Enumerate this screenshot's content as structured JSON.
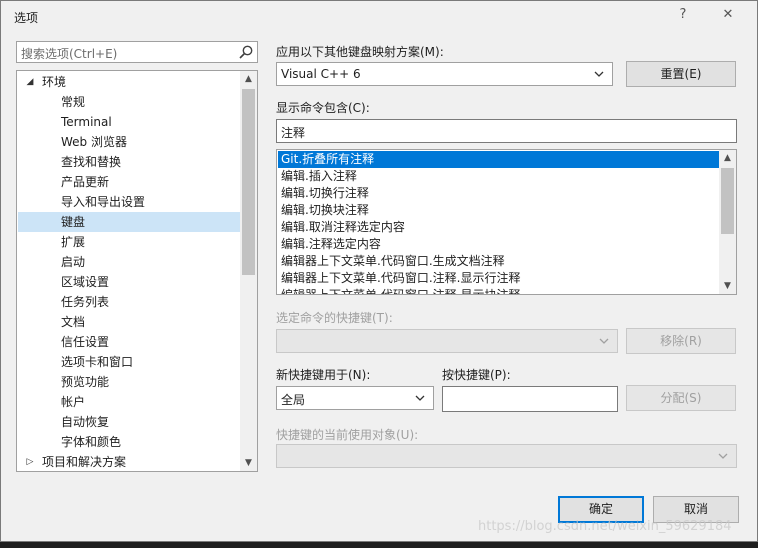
{
  "window": {
    "title": "选项",
    "help_label": "?",
    "close_label": "✕"
  },
  "search": {
    "placeholder": "搜索选项(Ctrl+E)"
  },
  "tree": {
    "items": [
      {
        "label": "环境",
        "level": 0,
        "expanded": true
      },
      {
        "label": "常规",
        "level": 1
      },
      {
        "label": "Terminal",
        "level": 1
      },
      {
        "label": "Web 浏览器",
        "level": 1
      },
      {
        "label": "查找和替换",
        "level": 1
      },
      {
        "label": "产品更新",
        "level": 1
      },
      {
        "label": "导入和导出设置",
        "level": 1
      },
      {
        "label": "键盘",
        "level": 1,
        "selected": true
      },
      {
        "label": "扩展",
        "level": 1
      },
      {
        "label": "启动",
        "level": 1
      },
      {
        "label": "区域设置",
        "level": 1
      },
      {
        "label": "任务列表",
        "level": 1
      },
      {
        "label": "文档",
        "level": 1
      },
      {
        "label": "信任设置",
        "level": 1
      },
      {
        "label": "选项卡和窗口",
        "level": 1
      },
      {
        "label": "预览功能",
        "level": 1
      },
      {
        "label": "帐户",
        "level": 1
      },
      {
        "label": "自动恢复",
        "level": 1
      },
      {
        "label": "字体和颜色",
        "level": 1
      },
      {
        "label": "项目和解决方案",
        "level": 0,
        "expanded": false
      }
    ]
  },
  "keymap": {
    "label": "应用以下其他键盘映射方案(M):",
    "value": "Visual C++ 6",
    "reset_label": "重置(E)"
  },
  "filter": {
    "label": "显示命令包含(C):",
    "value": "注释"
  },
  "commands": [
    "Git.折叠所有注释",
    "编辑.插入注释",
    "编辑.切换行注释",
    "编辑.切换块注释",
    "编辑.取消注释选定内容",
    "编辑.注释选定内容",
    "编辑器上下文菜单.代码窗口.生成文档注释",
    "编辑器上下文菜单.代码窗口.注释.显示行注释",
    "编辑器上下文菜单.代码窗口.注释.显示块注释"
  ],
  "selected_shortcuts": {
    "label": "选定命令的快捷键(T):",
    "remove_label": "移除(R)"
  },
  "new_shortcut": {
    "scope_label": "新快捷键用于(N):",
    "scope_value": "全局",
    "press_label": "按快捷键(P):",
    "press_value": "",
    "assign_label": "分配(S)"
  },
  "used_by": {
    "label": "快捷键的当前使用对象(U):"
  },
  "footer": {
    "ok_label": "确定",
    "cancel_label": "取消"
  },
  "watermark": "https://blog.csdn.net/weixin_59629184",
  "colors": {
    "selection": "#0078d7",
    "tree_selection": "#cce4f7",
    "dialog_bg": "#f0f0f0"
  }
}
